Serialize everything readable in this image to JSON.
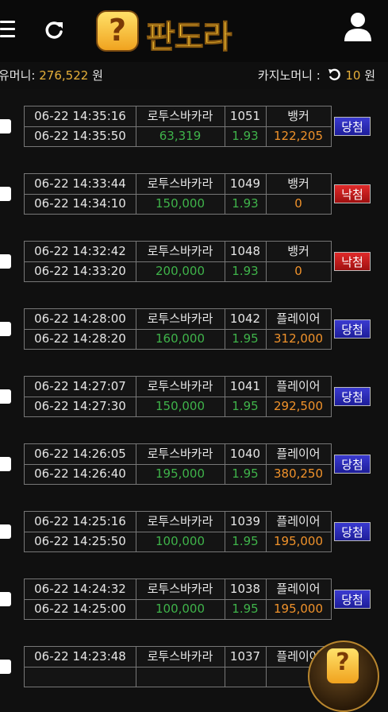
{
  "header": {
    "logo_text": "판도라",
    "logo_mark": "?"
  },
  "balance": {
    "user_money_label": "유머니:",
    "user_money_value": "276,522",
    "user_money_unit": "원",
    "casino_money_label": "카지노머니 :",
    "casino_money_value": "10",
    "casino_money_unit": "원"
  },
  "rows": [
    {
      "bet_time": "06-22 14:35:16",
      "result_time": "06-22 14:35:50",
      "game": "로투스바카라",
      "round": "1051",
      "amount": "63,319",
      "odds": "1.93",
      "pick": "뱅커",
      "payout": "122,205",
      "status": "당첨",
      "win": true
    },
    {
      "bet_time": "06-22 14:33:44",
      "result_time": "06-22 14:34:10",
      "game": "로투스바카라",
      "round": "1049",
      "amount": "150,000",
      "odds": "1.93",
      "pick": "뱅커",
      "payout": "0",
      "status": "낙첨",
      "win": false
    },
    {
      "bet_time": "06-22 14:32:42",
      "result_time": "06-22 14:33:20",
      "game": "로투스바카라",
      "round": "1048",
      "amount": "200,000",
      "odds": "1.93",
      "pick": "뱅커",
      "payout": "0",
      "status": "낙첨",
      "win": false
    },
    {
      "bet_time": "06-22 14:28:00",
      "result_time": "06-22 14:28:20",
      "game": "로투스바카라",
      "round": "1042",
      "amount": "160,000",
      "odds": "1.95",
      "pick": "플레이어",
      "payout": "312,000",
      "status": "당첨",
      "win": true
    },
    {
      "bet_time": "06-22 14:27:07",
      "result_time": "06-22 14:27:30",
      "game": "로투스바카라",
      "round": "1041",
      "amount": "150,000",
      "odds": "1.95",
      "pick": "플레이어",
      "payout": "292,500",
      "status": "당첨",
      "win": true
    },
    {
      "bet_time": "06-22 14:26:05",
      "result_time": "06-22 14:26:40",
      "game": "로투스바카라",
      "round": "1040",
      "amount": "195,000",
      "odds": "1.95",
      "pick": "플레이어",
      "payout": "380,250",
      "status": "당첨",
      "win": true
    },
    {
      "bet_time": "06-22 14:25:16",
      "result_time": "06-22 14:25:50",
      "game": "로투스바카라",
      "round": "1039",
      "amount": "100,000",
      "odds": "1.95",
      "pick": "플레이어",
      "payout": "195,000",
      "status": "당첨",
      "win": true
    },
    {
      "bet_time": "06-22 14:24:32",
      "result_time": "06-22 14:25:00",
      "game": "로투스바카라",
      "round": "1038",
      "amount": "100,000",
      "odds": "1.95",
      "pick": "플레이어",
      "payout": "195,000",
      "status": "당첨",
      "win": true
    },
    {
      "bet_time": "06-22 14:23:48",
      "result_time": "",
      "game": "로투스바카라",
      "round": "1037",
      "amount": "",
      "odds": "",
      "pick": "플레이어",
      "payout": "",
      "status": "",
      "win": true
    }
  ]
}
